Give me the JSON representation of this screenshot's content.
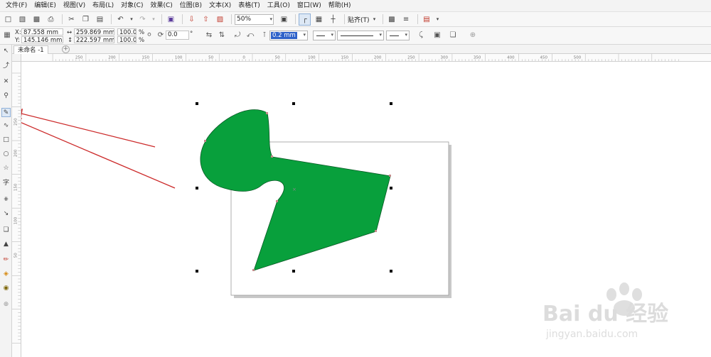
{
  "menu": {
    "items": [
      "文件(F)",
      "编辑(E)",
      "视图(V)",
      "布局(L)",
      "对象(C)",
      "效果(C)",
      "位图(B)",
      "文本(X)",
      "表格(T)",
      "工具(O)",
      "窗口(W)",
      "帮助(H)"
    ]
  },
  "toolbar": {
    "zoom": "50%",
    "snap_label": "贴齐(T)"
  },
  "properties": {
    "x_label": "X:",
    "x_value": "87.558 mm",
    "y_label": "Y:",
    "y_value": "145.146 mm",
    "width_value": "259.869 mm",
    "height_value": "222.597 mm",
    "scale_w": "100.0",
    "scale_h": "100.0",
    "percent_1": "%",
    "percent_2": "%",
    "rotation": "0.0",
    "degree": "°",
    "outline_width": "0.2 mm"
  },
  "document": {
    "tab_label": "未命名 -1",
    "add_tab": "+"
  },
  "ruler": {
    "h_labels": [
      "250",
      "200",
      "150",
      "100",
      "50",
      "0",
      "50",
      "100",
      "150",
      "200",
      "250",
      "300",
      "350",
      "400",
      "450",
      "500"
    ],
    "v_labels": [
      "250",
      "200",
      "150",
      "100",
      "50"
    ]
  },
  "watermark": {
    "brand": "Bai du 经验",
    "url": "jingyan.baidu.com"
  },
  "colors": {
    "shape_fill": "#08a03c",
    "arrow": "#cc2a2a",
    "selection_handle": "#000000",
    "page_shadow": "#c8c8c8"
  }
}
